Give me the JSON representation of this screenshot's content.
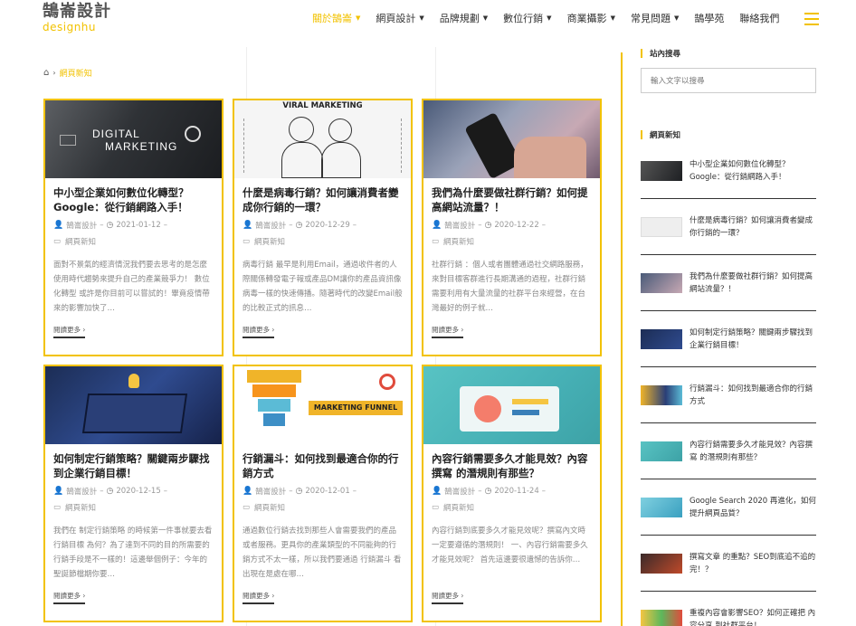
{
  "logo": {
    "cn": "鵠崙設計",
    "en": "designhu"
  },
  "nav": [
    {
      "label": "關於鵠崙",
      "caret": true
    },
    {
      "label": "網頁設計",
      "caret": true
    },
    {
      "label": "品牌規劃",
      "caret": true
    },
    {
      "label": "數位行銷",
      "caret": true
    },
    {
      "label": "商業攝影",
      "caret": true
    },
    {
      "label": "常見問題",
      "caret": true
    },
    {
      "label": "鵠學苑",
      "caret": false
    },
    {
      "label": "聯絡我們",
      "caret": false
    }
  ],
  "breadcrumb": {
    "current": "網頁新知"
  },
  "posts": [
    {
      "title": "中小型企業如何數位化轉型？Google：從行銷網路入手！",
      "author": "鵠崙設計",
      "date": "2021-01-12",
      "category": "網頁新知",
      "excerpt": "面對不景氣的經濟情況我們要去思考的是怎麼使用時代趨勢來提升自己的產業競爭力！ 數位化轉型 或許是你目前可以嘗試的！畢竟疫情帶來的影響加快了…",
      "more": "閱讀更多",
      "thumb_text": [
        "DIGITAL",
        "MARKETING"
      ]
    },
    {
      "title": "什麼是病毒行銷？如何讓消費者變成你行銷的一環？",
      "author": "鵠崙設計",
      "date": "2020-12-29",
      "category": "網頁新知",
      "excerpt": "病毒行銷 最早是利用Email，通過收件者的人際關係轉發電子報或產品DM讓你的產品資訊像病毒一樣的快速傳播。隨著時代的改變Email般的比較正式的訊息…",
      "more": "閱讀更多",
      "thumb_text": [
        "VIRAL MARKETING"
      ]
    },
    {
      "title": "我們為什麼要做社群行銷？如何提高網站流量？！",
      "author": "鵠崙設計",
      "date": "2020-12-22",
      "category": "網頁新知",
      "excerpt": "社群行銷 ：個人或者團體通過社交網路服務，來對目標客群進行長期溝通的過程，社群行銷需要利用有大量流量的社群平台來經營，在台灣最好的例子就…",
      "more": "閱讀更多",
      "thumb_text": []
    },
    {
      "title": "如何制定行銷策略？關鍵兩步驟找到企業行銷目標！",
      "author": "鵠崙設計",
      "date": "2020-12-15",
      "category": "網頁新知",
      "excerpt": "我們在 制定行銷策略 的時候第一件事就要去看 行銷目標 為何？為了達到不同的目的所需要的行銷手段是不一樣的！這邊舉個例子：今年的聖誕節檔期你要…",
      "more": "閱讀更多",
      "thumb_text": []
    },
    {
      "title": "行銷漏斗：如何找到最適合你的行銷方式",
      "author": "鵠崙設計",
      "date": "2020-12-01",
      "category": "網頁新知",
      "excerpt": "通過數位行銷去找到那些人會需要我們的產品或者服務。更具你的產業類型的不同能夠的行銷方式不太一樣，所以我們要通過 行銷漏斗 看出現在是處在哪…",
      "more": "閱讀更多",
      "thumb_text": [
        "MARKETING FUNNEL"
      ]
    },
    {
      "title": "內容行銷需要多久才能見效？內容撰寫 的潛規則有那些？",
      "author": "鵠崙設計",
      "date": "2020-11-24",
      "category": "網頁新知",
      "excerpt": "內容行銷到底要多久才能見效呢？撰寫內文時一定要遵循的潛規則！ 一、內容行銷需要多久才能見效呢？ 首先這邊要很遺憾的告訴你…",
      "more": "閱讀更多",
      "thumb_text": []
    }
  ],
  "sidebar": {
    "search_title": "站內搜尋",
    "search_placeholder": "輸入文字以搜尋",
    "recent_title": "網頁新知",
    "recent": [
      "中小型企業如何數位化轉型？Google：從行銷網路入手！",
      "什麼是病毒行銷？如何讓消費者變成你行銷的一環？",
      "我們為什麼要做社群行銷？如何提高網站流量？！",
      "如何制定行銷策略？關鍵兩步驟找到企業行銷目標！",
      "行銷漏斗：如何找到最適合你的行銷方式",
      "內容行銷需要多久才能見效？內容撰寫 的潛規則有那些？",
      "Google Search 2020 再進化，如何提升網頁品質？",
      "撰寫文章 的重點？SEO到底追不追的完！？",
      "重複內容會影響SEO？如何正確把 內容分享 到社群平台！"
    ]
  },
  "colors": {
    "accent": "#f2c200",
    "text": "#333333",
    "muted": "#999999"
  }
}
